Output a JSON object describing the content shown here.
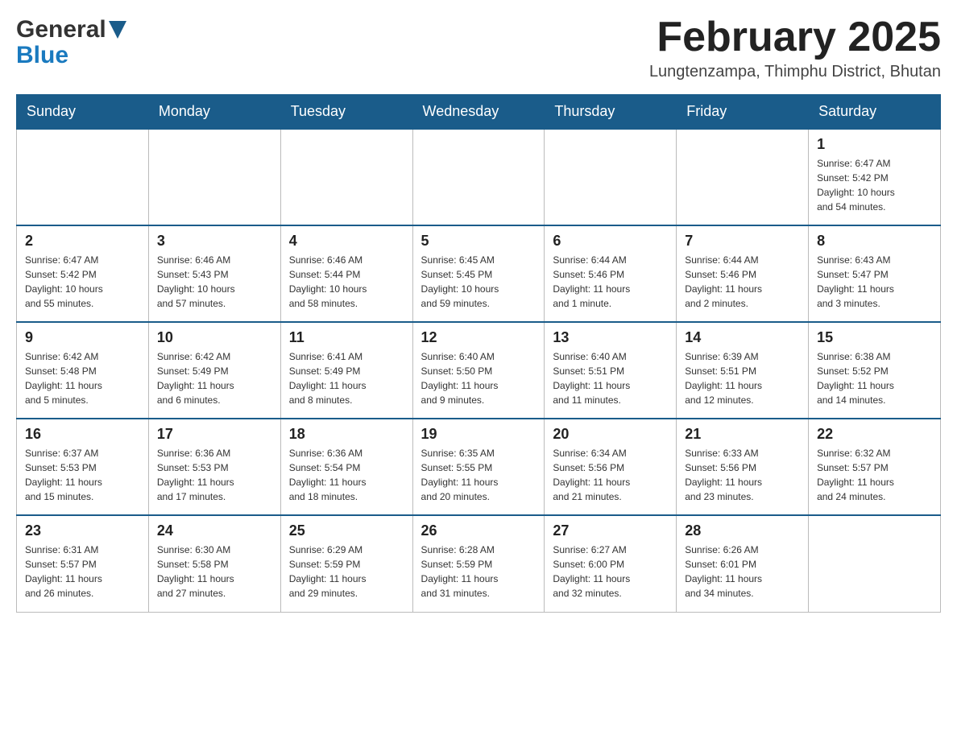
{
  "header": {
    "logo_general": "General",
    "logo_blue": "Blue",
    "title": "February 2025",
    "location": "Lungtenzampa, Thimphu District, Bhutan"
  },
  "calendar": {
    "days_of_week": [
      "Sunday",
      "Monday",
      "Tuesday",
      "Wednesday",
      "Thursday",
      "Friday",
      "Saturday"
    ],
    "weeks": [
      {
        "days": [
          {
            "num": "",
            "info": ""
          },
          {
            "num": "",
            "info": ""
          },
          {
            "num": "",
            "info": ""
          },
          {
            "num": "",
            "info": ""
          },
          {
            "num": "",
            "info": ""
          },
          {
            "num": "",
            "info": ""
          },
          {
            "num": "1",
            "info": "Sunrise: 6:47 AM\nSunset: 5:42 PM\nDaylight: 10 hours\nand 54 minutes."
          }
        ]
      },
      {
        "days": [
          {
            "num": "2",
            "info": "Sunrise: 6:47 AM\nSunset: 5:42 PM\nDaylight: 10 hours\nand 55 minutes."
          },
          {
            "num": "3",
            "info": "Sunrise: 6:46 AM\nSunset: 5:43 PM\nDaylight: 10 hours\nand 57 minutes."
          },
          {
            "num": "4",
            "info": "Sunrise: 6:46 AM\nSunset: 5:44 PM\nDaylight: 10 hours\nand 58 minutes."
          },
          {
            "num": "5",
            "info": "Sunrise: 6:45 AM\nSunset: 5:45 PM\nDaylight: 10 hours\nand 59 minutes."
          },
          {
            "num": "6",
            "info": "Sunrise: 6:44 AM\nSunset: 5:46 PM\nDaylight: 11 hours\nand 1 minute."
          },
          {
            "num": "7",
            "info": "Sunrise: 6:44 AM\nSunset: 5:46 PM\nDaylight: 11 hours\nand 2 minutes."
          },
          {
            "num": "8",
            "info": "Sunrise: 6:43 AM\nSunset: 5:47 PM\nDaylight: 11 hours\nand 3 minutes."
          }
        ]
      },
      {
        "days": [
          {
            "num": "9",
            "info": "Sunrise: 6:42 AM\nSunset: 5:48 PM\nDaylight: 11 hours\nand 5 minutes."
          },
          {
            "num": "10",
            "info": "Sunrise: 6:42 AM\nSunset: 5:49 PM\nDaylight: 11 hours\nand 6 minutes."
          },
          {
            "num": "11",
            "info": "Sunrise: 6:41 AM\nSunset: 5:49 PM\nDaylight: 11 hours\nand 8 minutes."
          },
          {
            "num": "12",
            "info": "Sunrise: 6:40 AM\nSunset: 5:50 PM\nDaylight: 11 hours\nand 9 minutes."
          },
          {
            "num": "13",
            "info": "Sunrise: 6:40 AM\nSunset: 5:51 PM\nDaylight: 11 hours\nand 11 minutes."
          },
          {
            "num": "14",
            "info": "Sunrise: 6:39 AM\nSunset: 5:51 PM\nDaylight: 11 hours\nand 12 minutes."
          },
          {
            "num": "15",
            "info": "Sunrise: 6:38 AM\nSunset: 5:52 PM\nDaylight: 11 hours\nand 14 minutes."
          }
        ]
      },
      {
        "days": [
          {
            "num": "16",
            "info": "Sunrise: 6:37 AM\nSunset: 5:53 PM\nDaylight: 11 hours\nand 15 minutes."
          },
          {
            "num": "17",
            "info": "Sunrise: 6:36 AM\nSunset: 5:53 PM\nDaylight: 11 hours\nand 17 minutes."
          },
          {
            "num": "18",
            "info": "Sunrise: 6:36 AM\nSunset: 5:54 PM\nDaylight: 11 hours\nand 18 minutes."
          },
          {
            "num": "19",
            "info": "Sunrise: 6:35 AM\nSunset: 5:55 PM\nDaylight: 11 hours\nand 20 minutes."
          },
          {
            "num": "20",
            "info": "Sunrise: 6:34 AM\nSunset: 5:56 PM\nDaylight: 11 hours\nand 21 minutes."
          },
          {
            "num": "21",
            "info": "Sunrise: 6:33 AM\nSunset: 5:56 PM\nDaylight: 11 hours\nand 23 minutes."
          },
          {
            "num": "22",
            "info": "Sunrise: 6:32 AM\nSunset: 5:57 PM\nDaylight: 11 hours\nand 24 minutes."
          }
        ]
      },
      {
        "days": [
          {
            "num": "23",
            "info": "Sunrise: 6:31 AM\nSunset: 5:57 PM\nDaylight: 11 hours\nand 26 minutes."
          },
          {
            "num": "24",
            "info": "Sunrise: 6:30 AM\nSunset: 5:58 PM\nDaylight: 11 hours\nand 27 minutes."
          },
          {
            "num": "25",
            "info": "Sunrise: 6:29 AM\nSunset: 5:59 PM\nDaylight: 11 hours\nand 29 minutes."
          },
          {
            "num": "26",
            "info": "Sunrise: 6:28 AM\nSunset: 5:59 PM\nDaylight: 11 hours\nand 31 minutes."
          },
          {
            "num": "27",
            "info": "Sunrise: 6:27 AM\nSunset: 6:00 PM\nDaylight: 11 hours\nand 32 minutes."
          },
          {
            "num": "28",
            "info": "Sunrise: 6:26 AM\nSunset: 6:01 PM\nDaylight: 11 hours\nand 34 minutes."
          },
          {
            "num": "",
            "info": ""
          }
        ]
      }
    ]
  }
}
